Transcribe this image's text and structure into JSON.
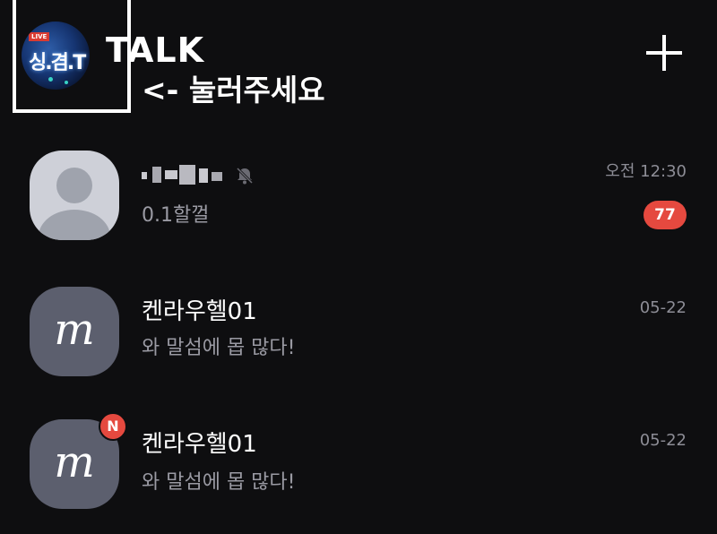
{
  "header": {
    "title": "TALK",
    "hint": "<- 눌러주세요",
    "profile_logo": {
      "badge_text": "LIVE",
      "logo_text": "싱.겸.T"
    },
    "add_icon": "plus-icon"
  },
  "chats": [
    {
      "name": "(pixelated name)",
      "name_censored": true,
      "muted": true,
      "mute_icon": "bell-slash-icon",
      "preview": "0.1할껄",
      "time": "오전 12:30",
      "unread": "77",
      "avatar": "default-person-avatar"
    },
    {
      "name": "켄라우헬01",
      "preview": "와 말섬에 몹 많다!",
      "time": "05-22",
      "avatar": "m-logo-avatar",
      "avatar_letter": "m"
    },
    {
      "name": "켄라우헬01",
      "preview": "와 말섬에 몹 많다!",
      "time": "05-22",
      "avatar": "m-logo-avatar",
      "avatar_letter": "m",
      "new_badge": "N"
    }
  ],
  "colors": {
    "background": "#0e0e10",
    "badge_red": "#e5493f",
    "preview_gray": "#9a9aa3",
    "avatar_m_bg": "#5c5f6e"
  }
}
